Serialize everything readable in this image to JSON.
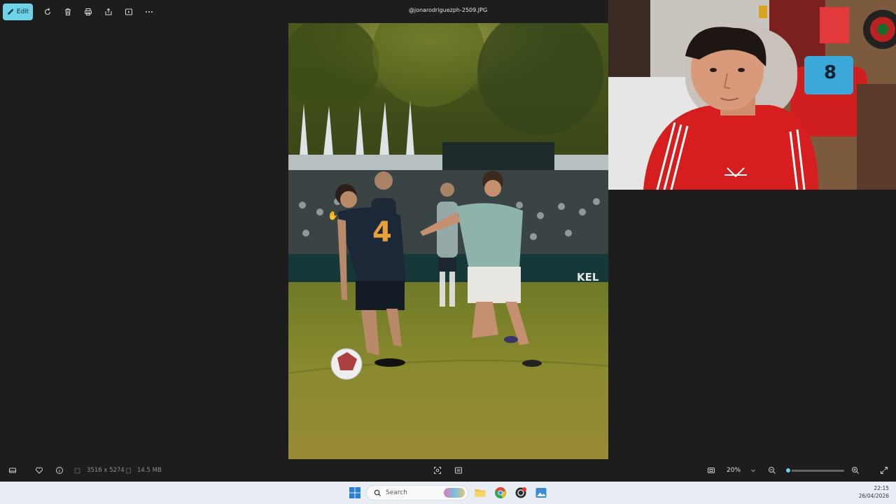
{
  "toolbar": {
    "edit_label": "Edit",
    "file_title": "@jonarodriguezph-2509.JPG"
  },
  "photo": {
    "jersey_number": "4",
    "ad_text": "KEL"
  },
  "webcam": {
    "shirt_number": "8"
  },
  "statusbar": {
    "dimensions": "3516 x 5274",
    "file_size": "14.5 MB",
    "zoom": "20%",
    "zoom_fraction": 0.05
  },
  "taskbar": {
    "search_placeholder": "Search",
    "time": "22:15",
    "date": "26/04/2026"
  },
  "colors": {
    "accent": "#6fd3e8",
    "background": "#1d1d1d"
  }
}
